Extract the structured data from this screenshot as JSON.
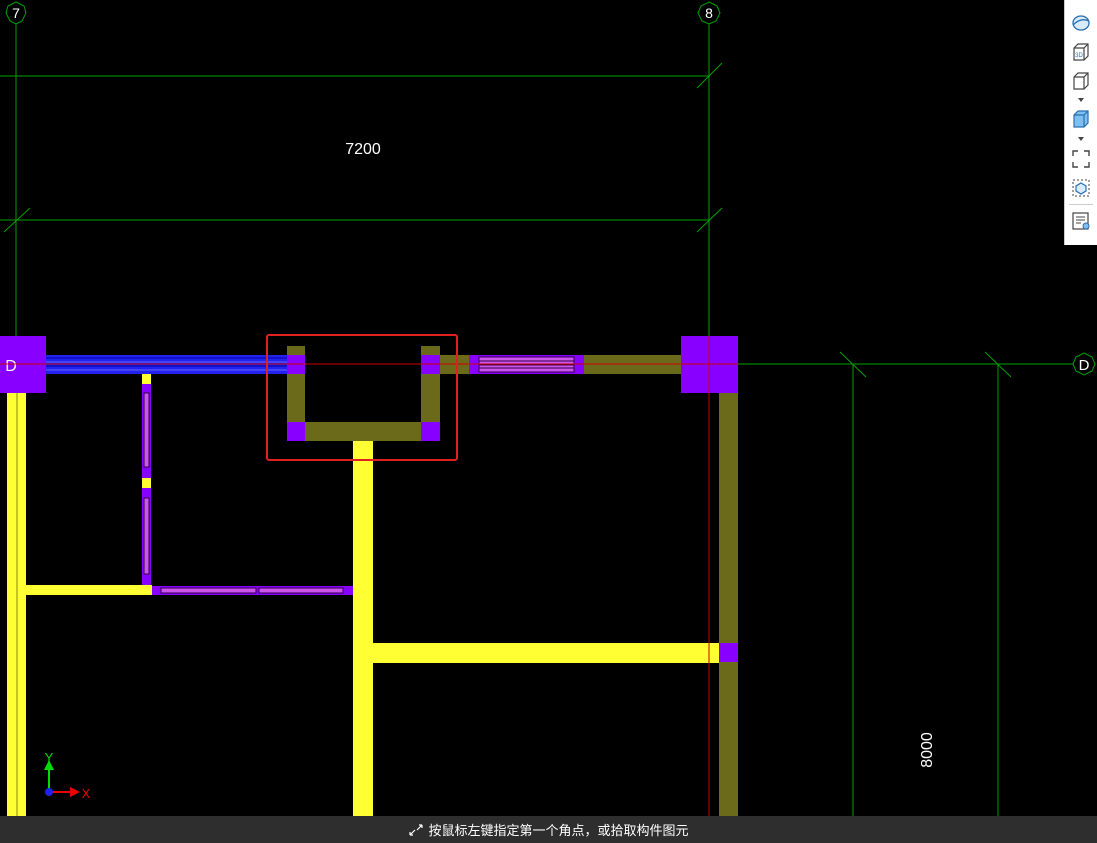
{
  "axes": {
    "col_left": "7",
    "col_right": "8",
    "row_left": "D",
    "row_right": "D"
  },
  "dimensions": {
    "horizontal": "7200",
    "vertical": "8000"
  },
  "ucs": {
    "y_label": "Y",
    "x_label": "X"
  },
  "toolbar": {
    "items": [
      {
        "icon": "orbit-view-icon"
      },
      {
        "icon": "3d-view-icon",
        "label": "3D"
      },
      {
        "icon": "cube-wireframe-icon"
      },
      {
        "icon": "cube-solid-icon"
      },
      {
        "icon": "zoom-extents-icon"
      },
      {
        "icon": "component-select-icon"
      },
      {
        "icon": "properties-panel-icon"
      }
    ]
  },
  "status": {
    "message": "按鼠标左键指定第一个角点，或拾取构件图元",
    "icon": "corner-arrows-icon"
  },
  "colors": {
    "axis_line": "#00a000",
    "selection_box": "#e02020",
    "column": "#8800ff",
    "wall_olive": "#6b6a1a",
    "wall_yellow": "#ffff33",
    "beam_blue": "#2222ee",
    "window": "#cc55ee",
    "red_axis": "#cc0000"
  }
}
